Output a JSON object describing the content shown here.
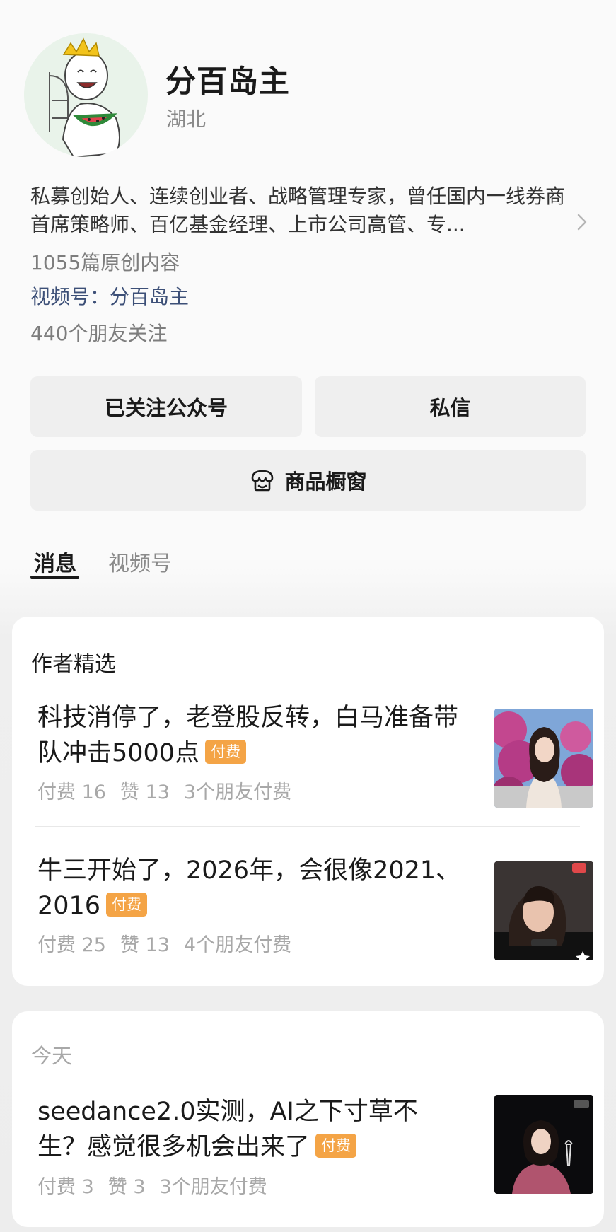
{
  "profile": {
    "name": "分百岛主",
    "region": "湖北",
    "bio": "私募创始人、连续创业者、战略管理专家，曾任国内一线券商首席策略师、百亿基金经理、上市公司高管、专...",
    "original_count": "1055篇原创内容",
    "channel_label": "视频号：",
    "channel_name": "分百岛主",
    "friends_following": "440个朋友关注"
  },
  "buttons": {
    "follow": "已关注公众号",
    "message": "私信",
    "shop": "商品橱窗"
  },
  "tabs": [
    {
      "label": "消息",
      "active": true
    },
    {
      "label": "视频号",
      "active": false
    }
  ],
  "featured": {
    "title": "作者精选",
    "articles": [
      {
        "title": "科技消停了，老登股反转，白马准备带队冲击5000点",
        "badge": "付费",
        "paid": "付费 16",
        "likes": "赞 13",
        "friends_paid": "3个朋友付费"
      },
      {
        "title": "牛三开始了，2026年，会很像2021、2016",
        "badge": "付费",
        "paid": "付费 25",
        "likes": "赞 13",
        "friends_paid": "4个朋友付费"
      }
    ]
  },
  "today": {
    "title": "今天",
    "articles": [
      {
        "title": "seedance2.0实测，AI之下寸草不生？感觉很多机会出来了",
        "badge": "付费",
        "paid": "付费 3",
        "likes": "赞 3",
        "friends_paid": "3个朋友付费"
      }
    ]
  },
  "icons": {
    "bio_chevron": "chevron-right-icon",
    "shop": "shop-bag-icon"
  },
  "colors": {
    "badge": "#f4a446",
    "channel_link": "#3c4f77",
    "button_bg": "#efefef"
  }
}
